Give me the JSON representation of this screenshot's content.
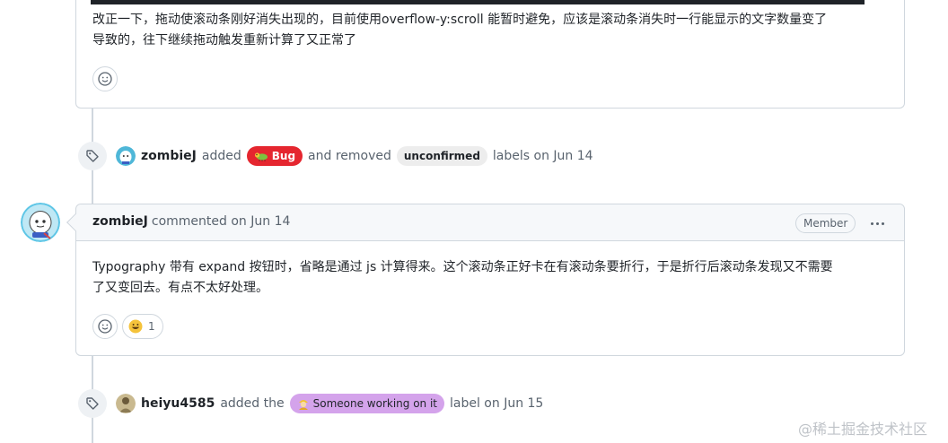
{
  "top_comment": {
    "body": "改正一下，拖动使滚动条刚好消失出现的，目前使用overflow-y:scroll 能暂时避免，应该是滚动条消失时一行能显示的文字数量变了导致的，往下继续拖动触发重新计算了又正常了",
    "line1": "改正一下，拖动使滚动条刚好消失出现的，目前使用overflow-y:scroll 能暂时避免，应该是滚动条消失时一行能显示的文字数量变了",
    "line2": "导致的，往下继续拖动触发重新计算了又正常了",
    "reaction_icon": "smiley-icon"
  },
  "event1": {
    "user": "zombieJ",
    "action_added": "added",
    "label_added": {
      "name": "Bug",
      "color": "#e5262f",
      "icon": "bug-icon"
    },
    "action_removed": "and removed",
    "label_removed": {
      "name": "unconfirmed",
      "color": "#ededed"
    },
    "suffix": "labels on Jun 14"
  },
  "comment": {
    "author": "zombieJ",
    "meta": "commented on Jun 14",
    "role_badge": "Member",
    "line1": "Typography 带有 expand 按钮时，省略是通过 js 计算得来。这个滚动条正好卡在有滚动条要折行，于是折行后滚动条发现又不需要",
    "line2": "了又变回去。有点不太好处理。",
    "reactions": [
      {
        "emoji": "grinning-face-icon",
        "count": "1"
      }
    ]
  },
  "event2": {
    "user": "heiyu4585",
    "action": "added the",
    "label": {
      "name": "Someone working on it",
      "color": "#d4a3eb",
      "icon": "construction-worker-icon"
    },
    "suffix": "label on Jun 15"
  },
  "watermark": "@稀土掘金技术社区",
  "colors": {
    "border": "#d0d7de",
    "muted": "#59636e",
    "header_bg": "#f6f8fa"
  }
}
